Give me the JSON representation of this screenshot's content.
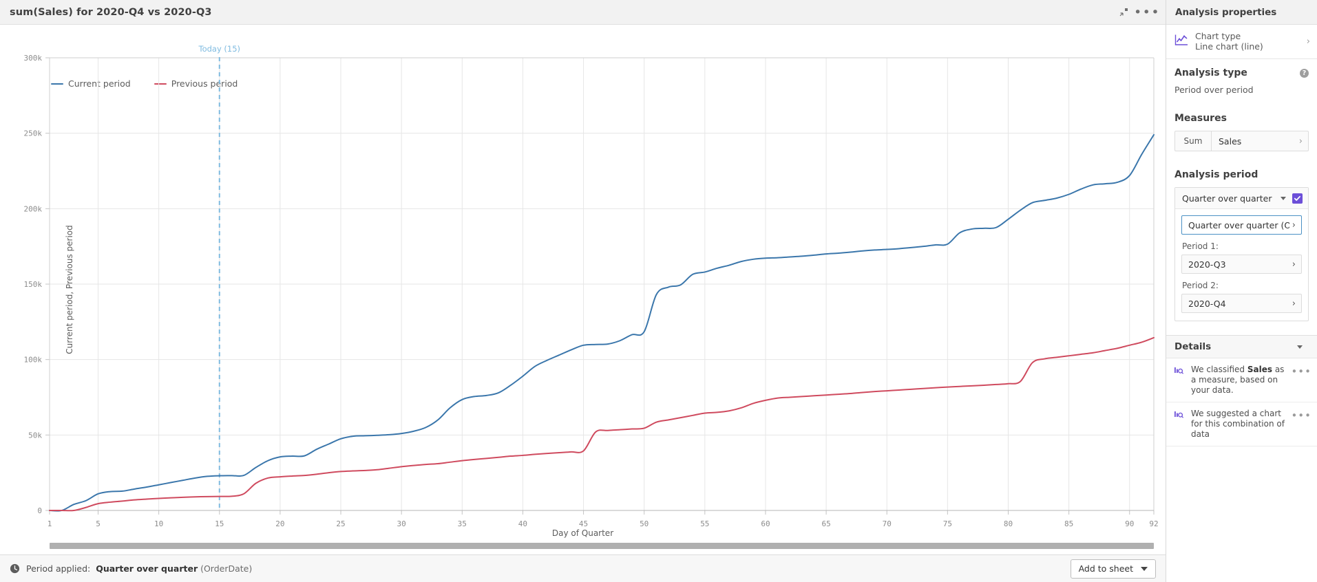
{
  "header": {
    "title": "sum(Sales) for 2020-Q4 vs 2020-Q3",
    "minimize_icon": "collapse-icon",
    "more_icon": "ellipsis-icon"
  },
  "footer": {
    "clock_icon": "clock-icon",
    "label": "Period applied:",
    "value_bold": "Quarter over quarter",
    "value_muted": "(OrderDate)",
    "add_to_sheet": "Add to sheet"
  },
  "sidebar": {
    "title": "Analysis properties",
    "chart_type": {
      "label": "Chart type",
      "value": "Line chart (line)",
      "icon": "line-chart-icon"
    },
    "analysis_type": {
      "title": "Analysis type",
      "value": "Period over period",
      "help_icon": "help-icon"
    },
    "measures": {
      "title": "Measures",
      "aggregation": "Sum",
      "field": "Sales"
    },
    "analysis_period": {
      "title": "Analysis period",
      "selected": "Quarter over quarter",
      "checked": true,
      "dimension": "Quarter over quarter (Order…",
      "period1_label": "Period 1:",
      "period1_value": "2020-Q3",
      "period2_label": "Period 2:",
      "period2_value": "2020-Q4"
    },
    "details": {
      "title": "Details",
      "items": [
        {
          "icon": "insight-icon",
          "text_pre": "We classified ",
          "text_bold": "Sales",
          "text_post": " as a measure, based on your data.",
          "more": "…"
        },
        {
          "icon": "insight-icon",
          "text_pre": "We suggested a chart for this combination of data",
          "text_bold": "",
          "text_post": "",
          "more": "…"
        }
      ]
    }
  },
  "colors": {
    "current": "#3a76ab",
    "previous": "#cf4a5e",
    "today_line": "#7fbbe0",
    "accent": "#6c4fd8",
    "grid": "#e6e6e6",
    "axis": "#9a9a9a"
  },
  "chart_data": {
    "type": "line",
    "title": "sum(Sales) for 2020-Q4 vs 2020-Q3",
    "xlabel": "Day of Quarter",
    "ylabel": "Current period, Previous period",
    "xlim": [
      1,
      92
    ],
    "ylim": [
      0,
      300000
    ],
    "ytick_labels": [
      "0",
      "50k",
      "100k",
      "150k",
      "200k",
      "250k",
      "300k"
    ],
    "ytick_values": [
      0,
      50000,
      100000,
      150000,
      200000,
      250000,
      300000
    ],
    "xtick_labels": [
      "1",
      "5",
      "10",
      "15",
      "20",
      "25",
      "30",
      "35",
      "40",
      "45",
      "50",
      "55",
      "60",
      "65",
      "70",
      "75",
      "80",
      "85",
      "90",
      "92"
    ],
    "xtick_values": [
      1,
      5,
      10,
      15,
      20,
      25,
      30,
      35,
      40,
      45,
      50,
      55,
      60,
      65,
      70,
      75,
      80,
      85,
      90,
      92
    ],
    "grid": true,
    "legend_position": "top-left",
    "legend": [
      "Current period",
      "Previous period"
    ],
    "annotations": [
      {
        "type": "vline",
        "label": "Today (15)",
        "x": 15,
        "color": "#7fbbe0",
        "style": "dashed"
      }
    ],
    "x": [
      1,
      2,
      3,
      4,
      5,
      6,
      7,
      8,
      9,
      10,
      11,
      12,
      13,
      14,
      15,
      16,
      17,
      18,
      19,
      20,
      21,
      22,
      23,
      24,
      25,
      26,
      27,
      28,
      29,
      30,
      31,
      32,
      33,
      34,
      35,
      36,
      37,
      38,
      39,
      40,
      41,
      42,
      43,
      44,
      45,
      46,
      47,
      48,
      49,
      50,
      51,
      52,
      53,
      54,
      55,
      56,
      57,
      58,
      59,
      60,
      61,
      62,
      63,
      64,
      65,
      66,
      67,
      68,
      69,
      70,
      71,
      72,
      73,
      74,
      75,
      76,
      77,
      78,
      79,
      80,
      81,
      82,
      83,
      84,
      85,
      86,
      87,
      88,
      89,
      90,
      91,
      92
    ],
    "series": [
      {
        "name": "Current period",
        "color": "#3a76ab",
        "values": [
          0,
          0,
          4000,
          6500,
          11000,
          12500,
          12800,
          14200,
          15500,
          17000,
          18500,
          20000,
          21500,
          22600,
          23000,
          23100,
          23200,
          28500,
          33000,
          35500,
          36000,
          36200,
          40500,
          44000,
          47500,
          49200,
          49500,
          49800,
          50200,
          51000,
          52500,
          55000,
          60000,
          68000,
          73500,
          75500,
          76200,
          78000,
          83000,
          89000,
          95500,
          99500,
          103000,
          106500,
          109500,
          110000,
          110300,
          112500,
          116500,
          118500,
          143000,
          148000,
          149500,
          156500,
          158000,
          160500,
          162500,
          165000,
          166500,
          167200,
          167500,
          168000,
          168500,
          169200,
          170000,
          170500,
          171200,
          172000,
          172600,
          173000,
          173500,
          174200,
          175000,
          176000,
          176500,
          184000,
          186500,
          187000,
          187500,
          193000,
          199000,
          204000,
          205500,
          207000,
          209500,
          213000,
          215800,
          216500,
          217500,
          222000,
          236000,
          249000
        ]
      },
      {
        "name": "Previous period",
        "color": "#cf4a5e",
        "values": [
          0,
          0,
          0,
          2000,
          4500,
          5500,
          6200,
          7000,
          7500,
          8000,
          8400,
          8700,
          9000,
          9200,
          9300,
          9400,
          11000,
          18000,
          21500,
          22300,
          22800,
          23200,
          24000,
          25000,
          25800,
          26200,
          26500,
          27000,
          28000,
          29000,
          29800,
          30500,
          31000,
          32000,
          33000,
          33800,
          34500,
          35200,
          36000,
          36500,
          37200,
          37800,
          38300,
          38800,
          39500,
          52000,
          53000,
          53500,
          54000,
          54500,
          58500,
          60000,
          61500,
          63000,
          64500,
          65000,
          66000,
          68000,
          71000,
          73000,
          74500,
          75000,
          75500,
          76000,
          76500,
          77000,
          77500,
          78200,
          78800,
          79300,
          79800,
          80300,
          80800,
          81300,
          81800,
          82200,
          82600,
          83000,
          83500,
          84000,
          85500,
          98000,
          100500,
          101500,
          102500,
          103500,
          104500,
          106000,
          107500,
          109500,
          111500,
          114500
        ]
      }
    ]
  }
}
